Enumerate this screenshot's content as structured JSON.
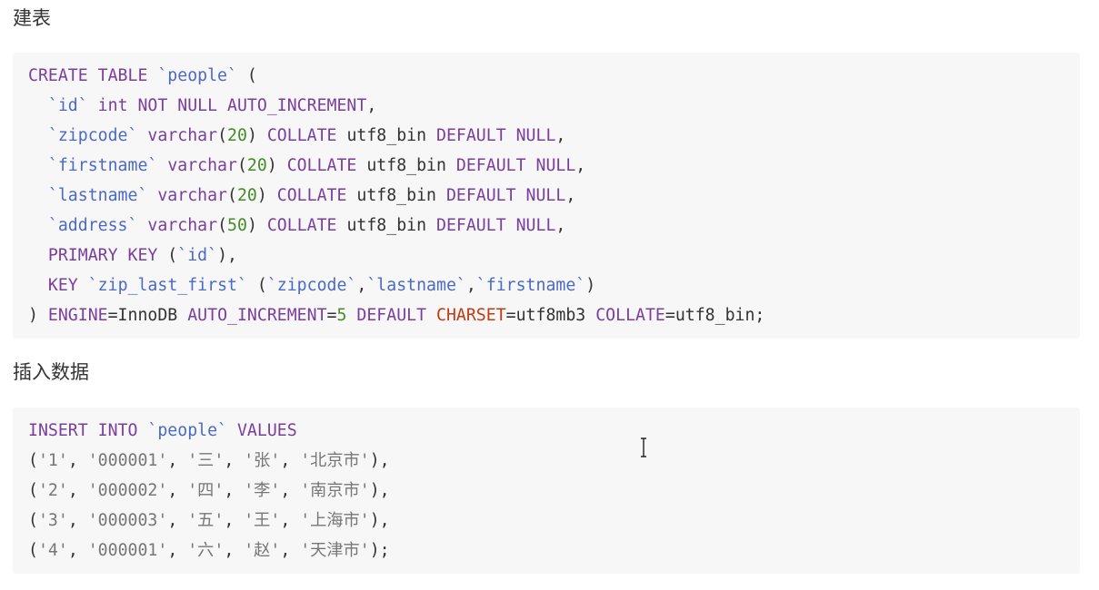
{
  "headings": {
    "create_table": "建表",
    "insert_data": "插入数据"
  },
  "colors": {
    "keyword": "#7a3e9d",
    "identifier": "#4b69c6",
    "number": "#448c27",
    "string": "#777777",
    "builtin": "#c33a11",
    "plain": "#333333",
    "code_background": "#f7f7f7"
  },
  "icons": {
    "cursor": "text-cursor-icon"
  },
  "code_blocks": [
    {
      "language": "sql",
      "lines": [
        [
          [
            "kw",
            "CREATE TABLE "
          ],
          [
            "nm",
            "`people`"
          ],
          [
            "id",
            " ("
          ]
        ],
        [
          [
            "id",
            "  "
          ],
          [
            "nm",
            "`id`"
          ],
          [
            "id",
            " "
          ],
          [
            "kw",
            "int NOT NULL AUTO_INCREMENT"
          ],
          [
            "id",
            ","
          ]
        ],
        [
          [
            "id",
            "  "
          ],
          [
            "nm",
            "`zipcode`"
          ],
          [
            "id",
            " "
          ],
          [
            "kw",
            "varchar"
          ],
          [
            "id",
            "("
          ],
          [
            "num",
            "20"
          ],
          [
            "id",
            ") "
          ],
          [
            "kw",
            "COLLATE"
          ],
          [
            "id",
            " utf8_bin "
          ],
          [
            "kw",
            "DEFAULT NULL"
          ],
          [
            "id",
            ","
          ]
        ],
        [
          [
            "id",
            "  "
          ],
          [
            "nm",
            "`firstname`"
          ],
          [
            "id",
            " "
          ],
          [
            "kw",
            "varchar"
          ],
          [
            "id",
            "("
          ],
          [
            "num",
            "20"
          ],
          [
            "id",
            ") "
          ],
          [
            "kw",
            "COLLATE"
          ],
          [
            "id",
            " utf8_bin "
          ],
          [
            "kw",
            "DEFAULT NULL"
          ],
          [
            "id",
            ","
          ]
        ],
        [
          [
            "id",
            "  "
          ],
          [
            "nm",
            "`lastname`"
          ],
          [
            "id",
            " "
          ],
          [
            "kw",
            "varchar"
          ],
          [
            "id",
            "("
          ],
          [
            "num",
            "20"
          ],
          [
            "id",
            ") "
          ],
          [
            "kw",
            "COLLATE"
          ],
          [
            "id",
            " utf8_bin "
          ],
          [
            "kw",
            "DEFAULT NULL"
          ],
          [
            "id",
            ","
          ]
        ],
        [
          [
            "id",
            "  "
          ],
          [
            "nm",
            "`address`"
          ],
          [
            "id",
            " "
          ],
          [
            "kw",
            "varchar"
          ],
          [
            "id",
            "("
          ],
          [
            "num",
            "50"
          ],
          [
            "id",
            ") "
          ],
          [
            "kw",
            "COLLATE"
          ],
          [
            "id",
            " utf8_bin "
          ],
          [
            "kw",
            "DEFAULT NULL"
          ],
          [
            "id",
            ","
          ]
        ],
        [
          [
            "id",
            "  "
          ],
          [
            "kw",
            "PRIMARY KEY"
          ],
          [
            "id",
            " ("
          ],
          [
            "nm",
            "`id`"
          ],
          [
            "id",
            "),"
          ]
        ],
        [
          [
            "id",
            "  "
          ],
          [
            "kw",
            "KEY"
          ],
          [
            "id",
            " "
          ],
          [
            "nm",
            "`zip_last_first`"
          ],
          [
            "id",
            " ("
          ],
          [
            "nm",
            "`zipcode`"
          ],
          [
            "id",
            ","
          ],
          [
            "nm",
            "`lastname`"
          ],
          [
            "id",
            ","
          ],
          [
            "nm",
            "`firstname`"
          ],
          [
            "id",
            ")"
          ]
        ],
        [
          [
            "id",
            ") "
          ],
          [
            "kw",
            "ENGINE"
          ],
          [
            "id",
            "=InnoDB "
          ],
          [
            "kw",
            "AUTO_INCREMENT"
          ],
          [
            "id",
            "="
          ],
          [
            "num",
            "5"
          ],
          [
            "id",
            " "
          ],
          [
            "kw",
            "DEFAULT"
          ],
          [
            "id",
            " "
          ],
          [
            "bi",
            "CHARSET"
          ],
          [
            "id",
            "=utf8mb3 "
          ],
          [
            "kw",
            "COLLATE"
          ],
          [
            "id",
            "=utf8_bin;"
          ]
        ]
      ]
    },
    {
      "language": "sql",
      "lines": [
        [
          [
            "kw",
            "INSERT INTO "
          ],
          [
            "nm",
            "`people`"
          ],
          [
            "kw",
            " VALUES"
          ]
        ],
        [
          [
            "id",
            "("
          ],
          [
            "str",
            "'1'"
          ],
          [
            "id",
            ", "
          ],
          [
            "str",
            "'000001'"
          ],
          [
            "id",
            ", "
          ],
          [
            "str",
            "'三'"
          ],
          [
            "id",
            ", "
          ],
          [
            "str",
            "'张'"
          ],
          [
            "id",
            ", "
          ],
          [
            "str",
            "'北京市'"
          ],
          [
            "id",
            "),"
          ]
        ],
        [
          [
            "id",
            "("
          ],
          [
            "str",
            "'2'"
          ],
          [
            "id",
            ", "
          ],
          [
            "str",
            "'000002'"
          ],
          [
            "id",
            ", "
          ],
          [
            "str",
            "'四'"
          ],
          [
            "id",
            ", "
          ],
          [
            "str",
            "'李'"
          ],
          [
            "id",
            ", "
          ],
          [
            "str",
            "'南京市'"
          ],
          [
            "id",
            "),"
          ]
        ],
        [
          [
            "id",
            "("
          ],
          [
            "str",
            "'3'"
          ],
          [
            "id",
            ", "
          ],
          [
            "str",
            "'000003'"
          ],
          [
            "id",
            ", "
          ],
          [
            "str",
            "'五'"
          ],
          [
            "id",
            ", "
          ],
          [
            "str",
            "'王'"
          ],
          [
            "id",
            ", "
          ],
          [
            "str",
            "'上海市'"
          ],
          [
            "id",
            "),"
          ]
        ],
        [
          [
            "id",
            "("
          ],
          [
            "str",
            "'4'"
          ],
          [
            "id",
            ", "
          ],
          [
            "str",
            "'000001'"
          ],
          [
            "id",
            ", "
          ],
          [
            "str",
            "'六'"
          ],
          [
            "id",
            ", "
          ],
          [
            "str",
            "'赵'"
          ],
          [
            "id",
            ", "
          ],
          [
            "str",
            "'天津市'"
          ],
          [
            "id",
            ");"
          ]
        ]
      ]
    }
  ]
}
